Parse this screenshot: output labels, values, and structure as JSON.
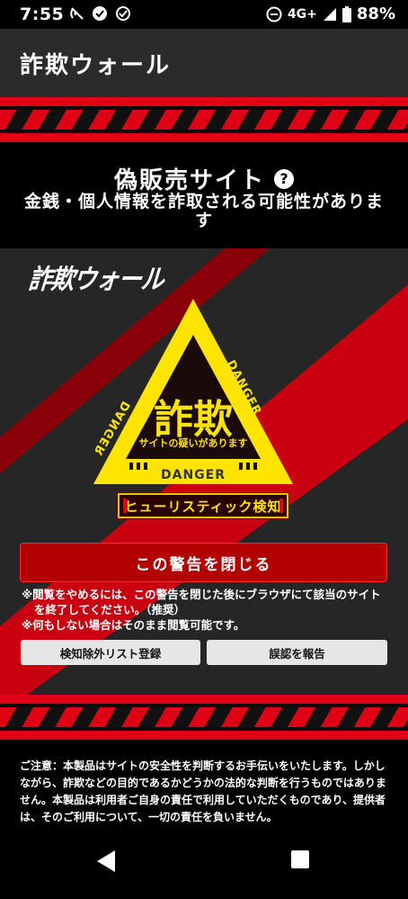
{
  "status_bar": {
    "time": "7:55",
    "network": "4G+",
    "battery": "88%"
  },
  "app_bar": {
    "title": "詐欺ウォール"
  },
  "headline": {
    "title": "偽販売サイト",
    "help_icon": "?",
    "subtitle": "金銭・個人情報を詐取される可能性があります"
  },
  "warning_panel": {
    "logo": "詐欺ウォール",
    "triangle_main": "詐欺",
    "triangle_sub": "サイトの疑いがあります",
    "danger_left": "DANGER",
    "danger_right": "DANGER",
    "danger_bottom": "DANGER",
    "badge": "ヒューリスティック検知",
    "close_button": "この警告を閉じる",
    "notes": [
      "※閲覧をやめるには、この警告を閉じた後にブラウザにて該当のサイトを終了してください。（推奨）",
      "※何もしない場合はそのまま閲覧可能です。"
    ],
    "exclude_button": "検知除外リスト登録",
    "report_button": "誤認を報告"
  },
  "disclaimer": "ご注意：本製品はサイトの安全性を判断するお手伝いをいたします。しかしながら、詐欺などの目的であるかどうかの法的な判断を行うものではありません。本製品は利用者ご自身の責任で利用していただくものであり、提供者は、そのご利用について、一切の責任を負いません。",
  "colors": {
    "accent_red": "#e00016",
    "warning_yellow": "#ffe400",
    "button_red": "#b30000"
  }
}
